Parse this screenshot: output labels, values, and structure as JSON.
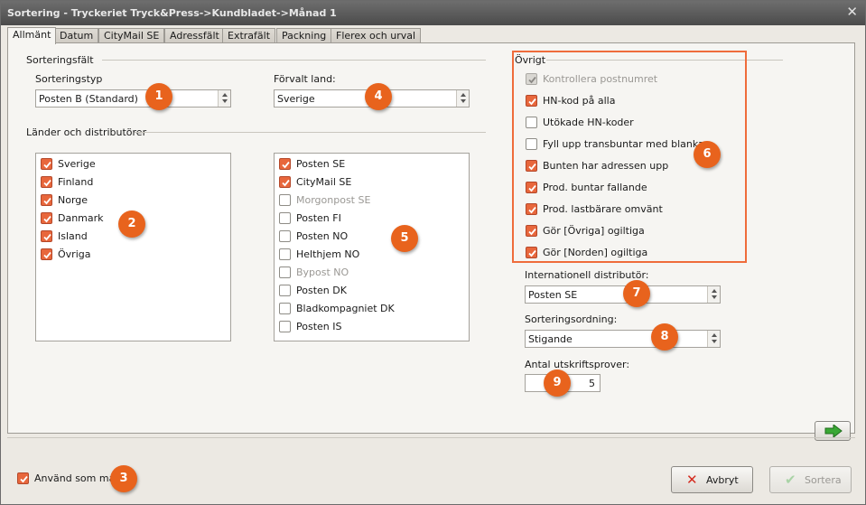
{
  "window": {
    "title": "Sortering - Tryckeriet Tryck&Press->Kundbladet->Månad 1"
  },
  "tabs": [
    "Allmänt",
    "Datum",
    "CityMail SE",
    "Adressfält",
    "Extrafält",
    "Packning",
    "Flerex och urval"
  ],
  "active_tab": "Allmänt",
  "sorting_fields": {
    "group_label": "Sorteringsfält",
    "type_label": "Sorteringstyp",
    "type_value": "Posten B (Standard)",
    "country_label": "Förvalt land:",
    "country_value": "Sverige"
  },
  "countries_group": {
    "label": "Länder och distributörer"
  },
  "countries": [
    {
      "label": "Sverige",
      "checked": true,
      "disabled": false
    },
    {
      "label": "Finland",
      "checked": true,
      "disabled": false
    },
    {
      "label": "Norge",
      "checked": true,
      "disabled": false
    },
    {
      "label": "Danmark",
      "checked": true,
      "disabled": false
    },
    {
      "label": "Island",
      "checked": true,
      "disabled": false
    },
    {
      "label": "Övriga",
      "checked": true,
      "disabled": false
    }
  ],
  "distributors": [
    {
      "label": "Posten SE",
      "checked": true,
      "disabled": false
    },
    {
      "label": "CityMail SE",
      "checked": true,
      "disabled": false
    },
    {
      "label": "Morgonpost SE",
      "checked": false,
      "disabled": true
    },
    {
      "label": "Posten FI",
      "checked": false,
      "disabled": false
    },
    {
      "label": "Posten NO",
      "checked": false,
      "disabled": false
    },
    {
      "label": "Helthjem NO",
      "checked": false,
      "disabled": false
    },
    {
      "label": "Bypost NO",
      "checked": false,
      "disabled": true
    },
    {
      "label": "Posten DK",
      "checked": false,
      "disabled": false
    },
    {
      "label": "Bladkompagniet DK",
      "checked": false,
      "disabled": false
    },
    {
      "label": "Posten IS",
      "checked": false,
      "disabled": false
    }
  ],
  "ovrigt": {
    "label": "Övrigt",
    "items": [
      {
        "label": "Kontrollera postnumret",
        "checked": true,
        "disabled": true
      },
      {
        "label": "HN-kod på alla",
        "checked": true,
        "disabled": false
      },
      {
        "label": "Utökade HN-koder",
        "checked": false,
        "disabled": false
      },
      {
        "label": "Fyll upp transbuntar med blanka",
        "checked": false,
        "disabled": false
      },
      {
        "label": "Bunten har adressen upp",
        "checked": true,
        "disabled": false
      },
      {
        "label": "Prod. buntar fallande",
        "checked": true,
        "disabled": false
      },
      {
        "label": "Prod. lastbärare omvänt",
        "checked": true,
        "disabled": false
      },
      {
        "label": "Gör [Övriga] ogiltiga",
        "checked": true,
        "disabled": false
      },
      {
        "label": "Gör [Norden] ogiltiga",
        "checked": true,
        "disabled": false
      }
    ]
  },
  "intl_distributor": {
    "label": "Internationell distributör:",
    "value": "Posten SE"
  },
  "sort_order": {
    "label": "Sorteringsordning:",
    "value": "Stigande"
  },
  "print_samples": {
    "label": "Antal utskriftsprover:",
    "value": "5"
  },
  "use_as_template": {
    "label": "Använd som mall",
    "checked": true
  },
  "buttons": {
    "cancel": "Avbryt",
    "sort": "Sortera"
  },
  "badges": [
    "1",
    "2",
    "3",
    "4",
    "5",
    "6",
    "7",
    "8",
    "9"
  ],
  "colors": {
    "accent": "#e8631d",
    "highlight_border": "#ef6c3b",
    "check_fill": "#e8673c"
  }
}
